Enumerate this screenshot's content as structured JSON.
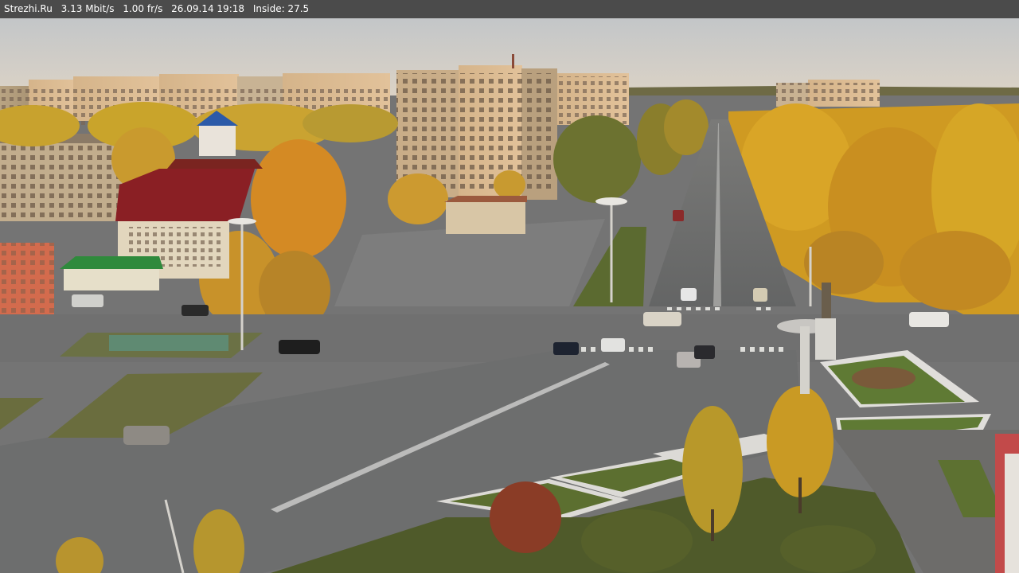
{
  "overlay": {
    "site": "Strezhi.Ru",
    "bitrate": "3.13 Mbit/s",
    "framerate": "1.00 fr/s",
    "datetime": "26.09.14 19:18",
    "inside": "Inside: 27.5"
  },
  "scene": {
    "description_colors": {
      "sky_top": "#c9cbcb",
      "sky_horizon": "#d9d0c4",
      "asphalt": "#6b6c6c",
      "plaza": "#7d7d7d",
      "grass": "#5f6a34",
      "foliage_gold": "#c79a1e",
      "foliage_orange": "#d08a22",
      "building_tan": "#c7b08f",
      "building_warm": "#d9b68a",
      "roof_red": "#8b2020"
    }
  }
}
